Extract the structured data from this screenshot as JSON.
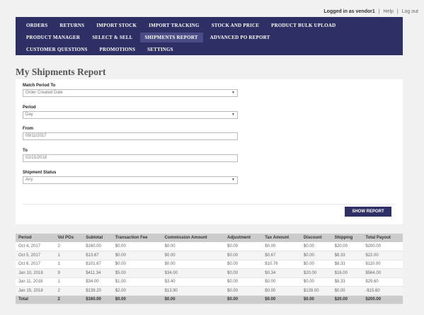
{
  "header": {
    "logged_in": "Logged in as vendor1",
    "help": "Help",
    "logout": "Log out"
  },
  "nav": {
    "row1": [
      "ORDERS",
      "RETURNS",
      "IMPORT STOCK",
      "IMPORT TRACKING",
      "STOCK AND PRICE",
      "PRODUCT BULK UPLOAD"
    ],
    "row2": [
      "PRODUCT MANAGER",
      "SELECT & SELL",
      "SHIPMENTS REPORT",
      "ADVANCED PO REPORT"
    ],
    "row3": [
      "CUSTOMER QUESTIONS",
      "PROMOTIONS",
      "SETTINGS"
    ],
    "active": "SHIPMENTS REPORT"
  },
  "page_title": "My Shipments Report",
  "form": {
    "match_period_label": "Match Period To",
    "match_period_value": "Order Created Date",
    "period_label": "Period",
    "period_value": "Day",
    "from_label": "From",
    "from_value": "09/11/2017",
    "to_label": "To",
    "to_value": "02/21/2018",
    "status_label": "Shipment Status",
    "status_value": "Any",
    "show_button": "SHOW REPORT"
  },
  "table": {
    "headers": [
      "Period",
      "Vol POs",
      "Subtotal",
      "Transaction Fee",
      "Commission Amount",
      "Adjustment",
      "Tax Amount",
      "Discount",
      "Shipping",
      "Total Payout"
    ],
    "rows": [
      [
        "Oct 4, 2017",
        "2",
        "$160.00",
        "$0.00",
        "$0.00",
        "$0.00",
        "$0.00",
        "$0.00",
        "$20.00",
        "$200.00"
      ],
      [
        "Oct 5, 2017",
        "1",
        "$13.67",
        "$0.00",
        "$0.00",
        "$0.00",
        "$0.67",
        "$0.00",
        "$8.33",
        "$22.00"
      ],
      [
        "Oct 6, 2017",
        "1",
        "$101.67",
        "$0.00",
        "$0.00",
        "$0.00",
        "$10.76",
        "$0.00",
        "$8.33",
        "$110.00"
      ],
      [
        "Jan 10, 2018",
        "9",
        "$411.34",
        "$5.00",
        "$34.00",
        "$0.00",
        "$0.34",
        "$20.00",
        "$16.00",
        "$564.00"
      ],
      [
        "Jan 11, 2018",
        "1",
        "$34.00",
        "$1.00",
        "$3.40",
        "$0.00",
        "$0.00",
        "$0.00",
        "$8.33",
        "$29.60"
      ],
      [
        "Jan 15, 2018",
        "2",
        "$139.20",
        "$2.00",
        "$13.90",
        "$0.00",
        "$0.00",
        "$139.00",
        "$0.00",
        "-$15.60"
      ]
    ],
    "total": [
      "Total",
      "2",
      "$160.00",
      "$0.00",
      "$0.00",
      "$0.00",
      "$0.00",
      "$0.00",
      "$20.00",
      "$200.00"
    ]
  }
}
